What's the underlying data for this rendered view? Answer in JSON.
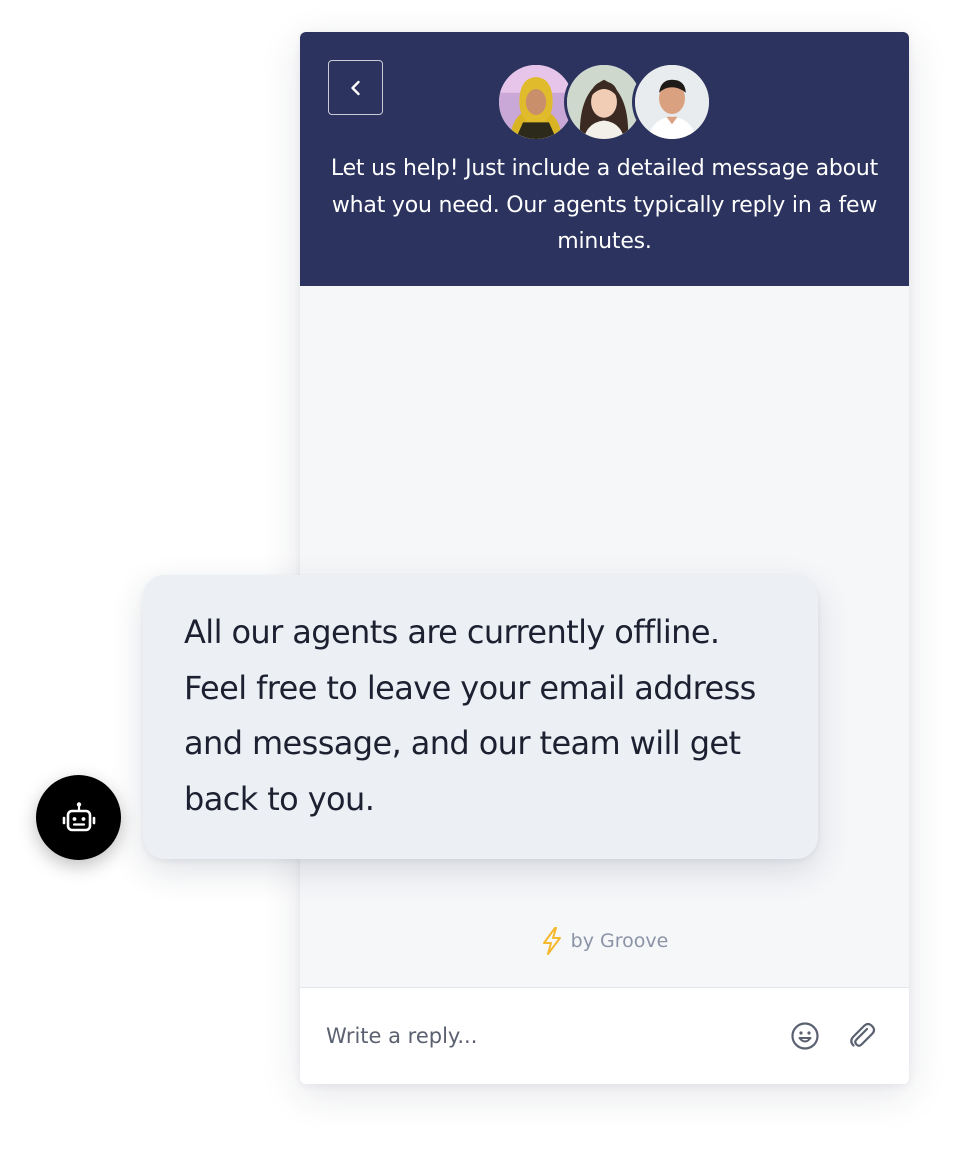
{
  "header": {
    "message": "Let us help! Just include a detailed message about what you need. Our agents typically reply in a few minutes.",
    "back_icon": "chevron-left-icon",
    "avatars": [
      "agent-avatar-1",
      "agent-avatar-2",
      "agent-avatar-3"
    ]
  },
  "bubble": {
    "text": "All our agents are currently offline. Feel free to leave your email address and message, and our team will get back to you."
  },
  "powered_by": {
    "label": "by Groove",
    "icon": "lightning-bolt-icon"
  },
  "composer": {
    "placeholder": "Write a reply...",
    "emoji_icon": "emoji-icon",
    "attach_icon": "paperclip-icon"
  },
  "launcher": {
    "icon": "robot-icon"
  },
  "colors": {
    "header_bg": "#2b335e",
    "panel_bg": "#f6f7f9",
    "bubble_bg": "#eceff4",
    "bolt": "#f5b82e",
    "launcher_bg": "#000000"
  }
}
